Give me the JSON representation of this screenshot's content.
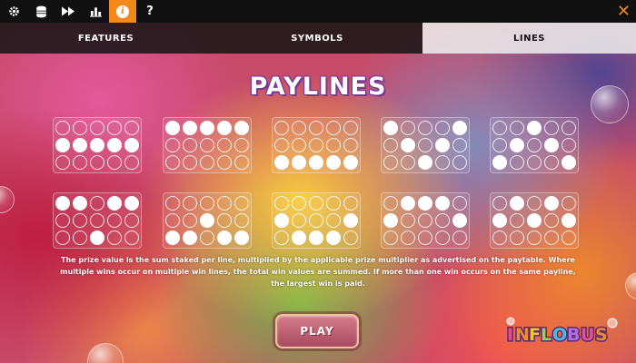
{
  "toolbar": {
    "icons": [
      "gear-icon",
      "coins-icon",
      "fast-forward-icon",
      "bar-chart-icon",
      "info-icon",
      "help-icon"
    ],
    "help_glyph": "?",
    "info_glyph": "i",
    "close_glyph": "✕",
    "accent_color": "#f28a1a"
  },
  "tabs": [
    {
      "label": "FEATURES",
      "active": false
    },
    {
      "label": "SYMBOLS",
      "active": false
    },
    {
      "label": "LINES",
      "active": true
    }
  ],
  "title": "PAYLINES",
  "paylines": [
    [
      [
        0,
        0,
        0,
        0,
        0
      ],
      [
        1,
        1,
        1,
        1,
        1
      ],
      [
        0,
        0,
        0,
        0,
        0
      ]
    ],
    [
      [
        1,
        1,
        1,
        1,
        1
      ],
      [
        0,
        0,
        0,
        0,
        0
      ],
      [
        0,
        0,
        0,
        0,
        0
      ]
    ],
    [
      [
        0,
        0,
        0,
        0,
        0
      ],
      [
        0,
        0,
        0,
        0,
        0
      ],
      [
        1,
        1,
        1,
        1,
        1
      ]
    ],
    [
      [
        1,
        0,
        0,
        0,
        1
      ],
      [
        0,
        1,
        0,
        1,
        0
      ],
      [
        0,
        0,
        1,
        0,
        0
      ]
    ],
    [
      [
        0,
        0,
        1,
        0,
        0
      ],
      [
        0,
        1,
        0,
        1,
        0
      ],
      [
        1,
        0,
        0,
        0,
        1
      ]
    ],
    [
      [
        1,
        1,
        0,
        1,
        1
      ],
      [
        0,
        0,
        0,
        0,
        0
      ],
      [
        0,
        0,
        1,
        0,
        0
      ]
    ],
    [
      [
        0,
        0,
        0,
        0,
        0
      ],
      [
        0,
        0,
        1,
        0,
        0
      ],
      [
        1,
        1,
        0,
        1,
        1
      ]
    ],
    [
      [
        0,
        0,
        0,
        0,
        0
      ],
      [
        1,
        0,
        0,
        0,
        1
      ],
      [
        0,
        1,
        1,
        1,
        0
      ]
    ],
    [
      [
        0,
        1,
        1,
        1,
        0
      ],
      [
        1,
        0,
        0,
        0,
        1
      ],
      [
        0,
        0,
        0,
        0,
        0
      ]
    ],
    [
      [
        0,
        1,
        0,
        1,
        0
      ],
      [
        1,
        0,
        1,
        0,
        1
      ],
      [
        0,
        0,
        0,
        0,
        0
      ]
    ]
  ],
  "description": "The prize value is the sum staked per line, multiplied by the applicable prize multiplier as advertised on the paytable. Where multiple wins occur on multiple win lines, the total win values are summed. If more than one win occurs on the same payline, the largest win is paid.",
  "play_button": "PLAY",
  "logo_text": "INFLOBUS"
}
